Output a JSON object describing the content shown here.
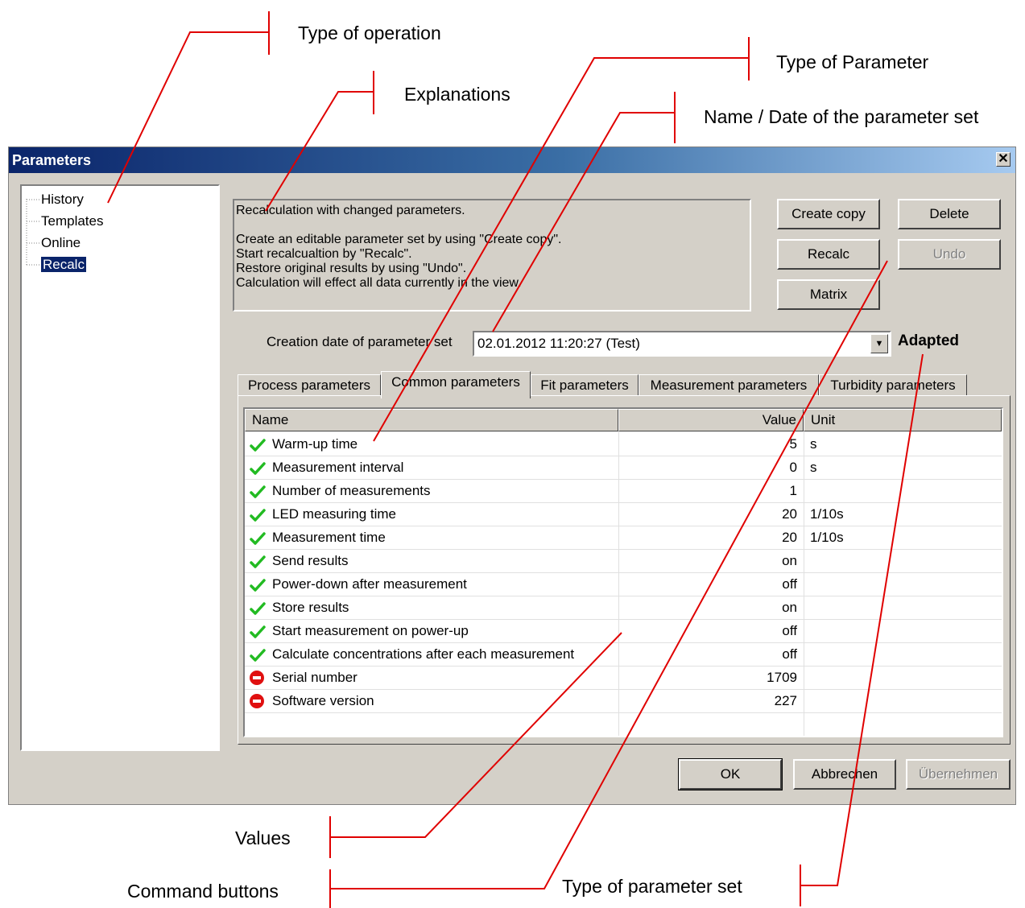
{
  "window": {
    "title": "Parameters",
    "close_glyph": "✕"
  },
  "tree": {
    "items": [
      {
        "label": "History",
        "selected": false
      },
      {
        "label": "Templates",
        "selected": false
      },
      {
        "label": "Online",
        "selected": false
      },
      {
        "label": "Recalc",
        "selected": true
      }
    ]
  },
  "explanation": {
    "lines": [
      "Recalculation with changed parameters.",
      "",
      "Create an editable parameter set by using \"Create copy\".",
      "Start recalcualtion by \"Recalc\".",
      "Restore original results by using \"Undo\".",
      "Calculation will effect all data currently in the view."
    ]
  },
  "command_buttons": {
    "create_copy": "Create copy",
    "delete": "Delete",
    "recalc": "Recalc",
    "undo": "Undo",
    "matrix": "Matrix"
  },
  "parameter_set": {
    "label": "Creation date of parameter set",
    "value": "02.01.2012 11:20:27 (Test)",
    "type": "Adapted"
  },
  "tabs": [
    {
      "label": "Process parameters",
      "active": false
    },
    {
      "label": "Common parameters",
      "active": true
    },
    {
      "label": "Fit parameters",
      "active": false
    },
    {
      "label": "Measurement parameters",
      "active": false
    },
    {
      "label": "Turbidity parameters",
      "active": false
    }
  ],
  "grid": {
    "columns": {
      "name": "Name",
      "value": "Value",
      "unit": "Unit"
    },
    "rows": [
      {
        "name": "Warm-up time",
        "value": "5",
        "unit": "s",
        "status": "ok"
      },
      {
        "name": "Measurement interval",
        "value": "0",
        "unit": "s",
        "status": "ok"
      },
      {
        "name": "Number of measurements",
        "value": "1",
        "unit": "",
        "status": "ok"
      },
      {
        "name": "LED measuring time",
        "value": "20",
        "unit": "1/10s",
        "status": "ok"
      },
      {
        "name": "Measurement time",
        "value": "20",
        "unit": "1/10s",
        "status": "ok"
      },
      {
        "name": "Send results",
        "value": "on",
        "unit": "",
        "status": "ok"
      },
      {
        "name": "Power-down after measurement",
        "value": "off",
        "unit": "",
        "status": "ok"
      },
      {
        "name": "Store results",
        "value": "on",
        "unit": "",
        "status": "ok"
      },
      {
        "name": "Start measurement on power-up",
        "value": "off",
        "unit": "",
        "status": "ok"
      },
      {
        "name": "Calculate concentrations after each measurement",
        "value": "off",
        "unit": "",
        "status": "ok"
      },
      {
        "name": "Serial number",
        "value": "1709",
        "unit": "",
        "status": "locked"
      },
      {
        "name": "Software version",
        "value": "227",
        "unit": "",
        "status": "locked"
      }
    ]
  },
  "dialog_buttons": {
    "ok": "OK",
    "cancel": "Abbrechen",
    "apply": "Übernehmen"
  },
  "annotations": {
    "type_of_operation": "Type of operation",
    "type_of_parameter": "Type of Parameter",
    "explanations": "Explanations",
    "name_date": "Name / Date of the parameter set",
    "values": "Values",
    "command_buttons": "Command buttons",
    "type_of_parameter_set": "Type of parameter set"
  },
  "colors": {
    "annotation_line": "#e00000",
    "title_start": "#0a246a",
    "title_end": "#a6caf0",
    "ok_check": "#22bb22",
    "stop": "#e01010"
  }
}
